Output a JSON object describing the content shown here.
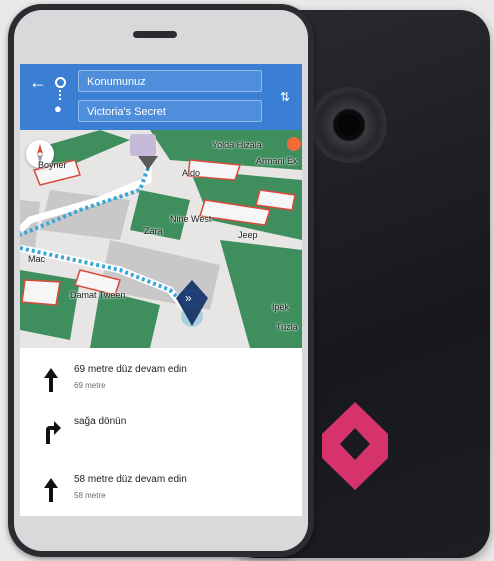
{
  "colors": {
    "accent": "#3b7fd4",
    "map_green": "#3f8f5e",
    "route": "#3aa6d8",
    "logo": "#d6336c",
    "device": "#1d1e22"
  },
  "navigation": {
    "back_icon": "back-arrow-icon",
    "origin": "Konumunuz",
    "destination": "Victoria's Secret",
    "swap_icon": "swap-icon"
  },
  "map": {
    "compass_icon": "compass-icon",
    "labels": [
      {
        "text": "Yolda Hizala"
      },
      {
        "text": "Armani Ex"
      },
      {
        "text": "Aldo"
      },
      {
        "text": "Boyner"
      },
      {
        "text": "Nine West"
      },
      {
        "text": "Jeep"
      },
      {
        "text": "Mac"
      },
      {
        "text": "Damat Tween"
      },
      {
        "text": "Ipek"
      },
      {
        "text": "Tuzla"
      },
      {
        "text": "Zara"
      }
    ]
  },
  "directions": [
    {
      "icon": "arrow-up-icon",
      "title": "69 metre düz devam edin",
      "subtitle": "69 metre"
    },
    {
      "icon": "turn-right-icon",
      "title": "sağa dönün",
      "subtitle": ""
    },
    {
      "icon": "arrow-up-icon",
      "title": "58 metre düz devam edin",
      "subtitle": "58 metre"
    }
  ]
}
